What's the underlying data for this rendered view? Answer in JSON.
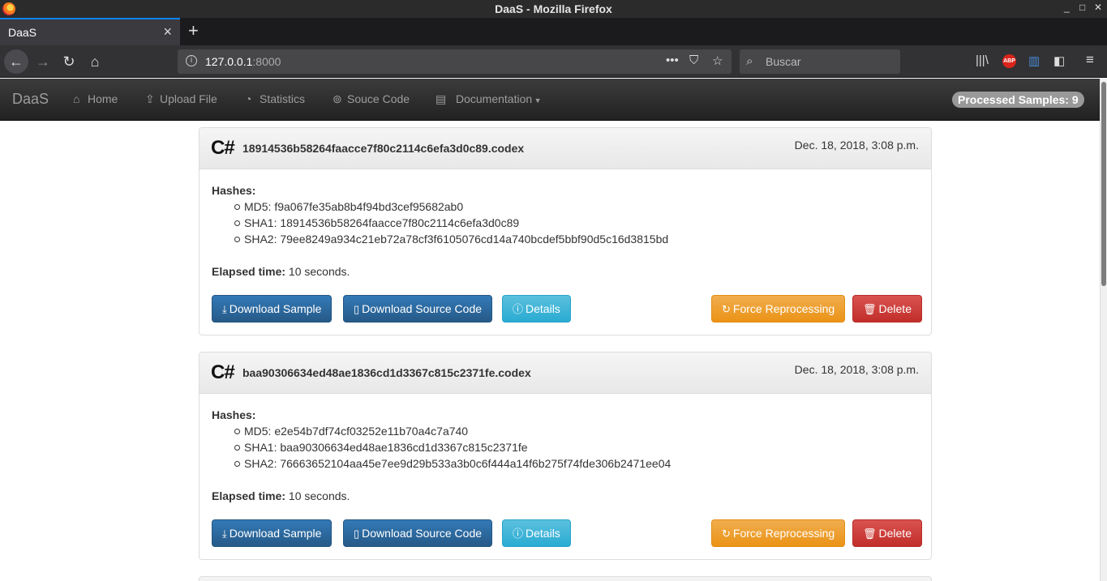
{
  "os": {
    "window_title": "DaaS - Mozilla Firefox",
    "controls": [
      "_",
      "□",
      "✕"
    ]
  },
  "browser": {
    "tab_title": "DaaS",
    "tab_close": "×",
    "new_tab": "+",
    "url_host": "127.0.0.1",
    "url_port": ":8000",
    "search_placeholder": "Buscar",
    "abp_label": "ABP"
  },
  "navbar": {
    "brand": "DaaS",
    "items": [
      "Home",
      "Upload File",
      "Statistics",
      "Souce Code",
      "Documentation"
    ],
    "processed_label": "Processed Samples: 9"
  },
  "samples": [
    {
      "lang": "C#",
      "file": "18914536b58264faacce7f80c2114c6efa3d0c89.codex",
      "date": "Dec. 18, 2018, 3:08 p.m.",
      "hashes_title": "Hashes:",
      "hashes": [
        "MD5: f9a067fe35ab8b4f94bd3cef95682ab0",
        "SHA1: 18914536b58264faacce7f80c2114c6efa3d0c89",
        "SHA2: 79ee8249a934c21eb72a78cf3f6105076cd14a740bcdef5bbf90d5c16d3815bd"
      ],
      "elapsed_label": "Elapsed time:",
      "elapsed_value": " 10 seconds."
    },
    {
      "lang": "C#",
      "file": "baa90306634ed48ae1836cd1d3367c815c2371fe.codex",
      "date": "Dec. 18, 2018, 3:08 p.m.",
      "hashes_title": "Hashes:",
      "hashes": [
        "MD5: e2e54b7df74cf03252e11b70a4c7a740",
        "SHA1: baa90306634ed48ae1836cd1d3367c815c2371fe",
        "SHA2: 76663652104aa45e7ee9d29b533a3b0c6f444a14f6b275f74fde306b2471ee04"
      ],
      "elapsed_label": "Elapsed time:",
      "elapsed_value": " 10 seconds."
    }
  ],
  "buttons": {
    "download_sample": "Download Sample",
    "download_source": "Download Source Code",
    "details": "Details",
    "force": "Force Reprocessing",
    "delete": "Delete"
  },
  "colors": {
    "primary": "#337ab7",
    "info": "#5bc0de",
    "warning": "#f0ad4e",
    "danger": "#d9534f",
    "navbar": "#222222"
  },
  "icons": {
    "home": "home-icon",
    "upload": "upload-icon",
    "statistics": "pie-chart-icon",
    "source": "github-icon",
    "docs": "book-icon"
  }
}
